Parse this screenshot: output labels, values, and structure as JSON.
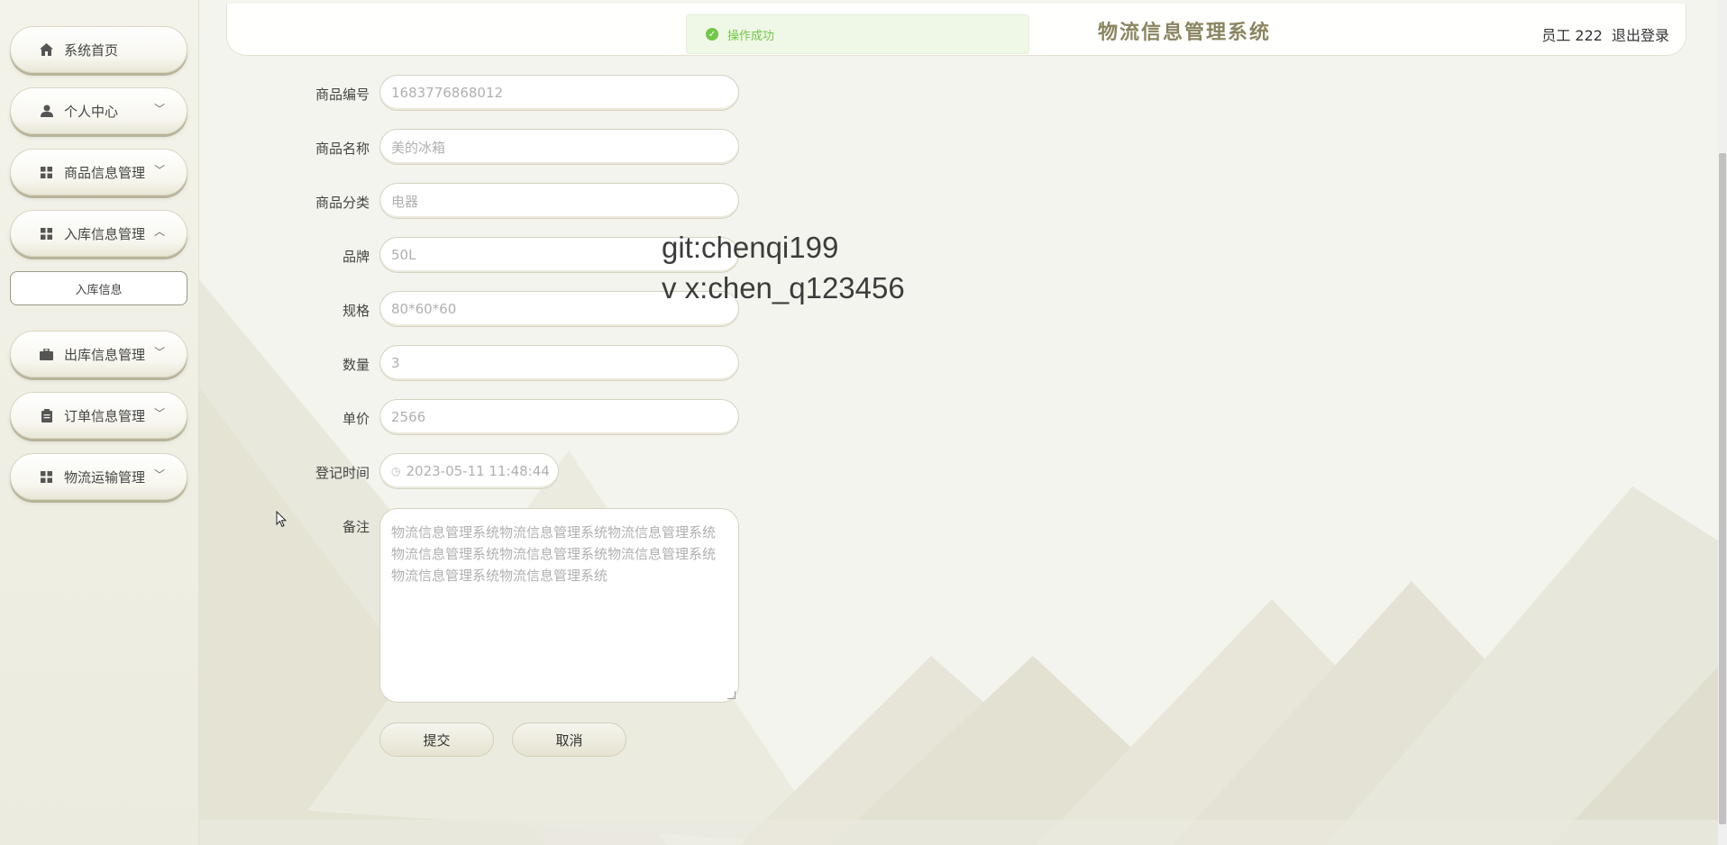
{
  "sidebar": {
    "items": [
      {
        "label": "系统首页",
        "icon": "home-icon",
        "chevron": ""
      },
      {
        "label": "个人中心",
        "icon": "user-icon",
        "chevron": "﹀"
      },
      {
        "label": "商品信息管理",
        "icon": "grid-icon",
        "chevron": "﹀"
      },
      {
        "label": "入库信息管理",
        "icon": "grid-icon",
        "chevron": "︿"
      },
      {
        "label": "出库信息管理",
        "icon": "briefcase-icon",
        "chevron": "﹀"
      },
      {
        "label": "订单信息管理",
        "icon": "clipboard-icon",
        "chevron": "﹀"
      },
      {
        "label": "物流运输管理",
        "icon": "grid-icon",
        "chevron": "﹀"
      }
    ],
    "submenu": {
      "label": "入库信息"
    }
  },
  "header": {
    "title": "物流信息管理系统",
    "user_label": "员工 222",
    "logout_label": "退出登录"
  },
  "toast": {
    "message": "操作成功",
    "color": "#67c23a"
  },
  "form": {
    "fields": [
      {
        "label": "商品编号",
        "value": "1683776868012"
      },
      {
        "label": "商品名称",
        "value": "美的冰箱"
      },
      {
        "label": "商品分类",
        "value": "电器"
      },
      {
        "label": "品牌",
        "value": "50L"
      },
      {
        "label": "规格",
        "value": "80*60*60"
      },
      {
        "label": "数量",
        "value": "3"
      },
      {
        "label": "单价",
        "value": "2566"
      },
      {
        "label": "登记时间",
        "value": "2023-05-11 11:48:44"
      },
      {
        "label": "备注",
        "value": "物流信息管理系统物流信息管理系统物流信息管理系统物流信息管理系统物流信息管理系统物流信息管理系统物流信息管理系统物流信息管理系统"
      }
    ],
    "submit_label": "提交",
    "cancel_label": "取消"
  },
  "watermark": {
    "line1": "git:chenqi199",
    "line2": "v x:chen_q123456"
  },
  "colors": {
    "accent": "#8a8560",
    "sidebar_bg": "#eeeee3",
    "button_shadow": "#b8b49a"
  }
}
